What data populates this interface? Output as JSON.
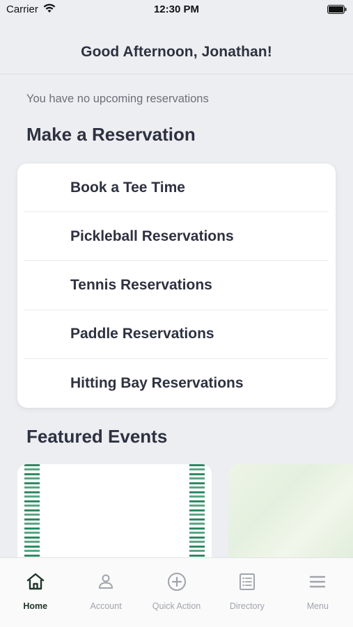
{
  "status_bar": {
    "carrier": "Carrier",
    "time": "12:30 PM"
  },
  "header": {
    "greeting": "Good Afternoon, Jonathan!"
  },
  "reservations": {
    "empty_message": "You have no upcoming reservations",
    "section_title": "Make a Reservation",
    "items": [
      {
        "label": "Book a Tee Time"
      },
      {
        "label": "Pickleball Reservations"
      },
      {
        "label": "Tennis Reservations"
      },
      {
        "label": "Paddle Reservations"
      },
      {
        "label": "Hitting Bay Reservations"
      }
    ]
  },
  "events": {
    "section_title": "Featured Events"
  },
  "tab_bar": {
    "active": "home",
    "active_color": "#1f3528",
    "inactive_color": "#a0a4ab",
    "tabs": [
      {
        "label": "Home",
        "icon": "home-icon"
      },
      {
        "label": "Account",
        "icon": "person-icon"
      },
      {
        "label": "Quick Action",
        "icon": "plus-circle-icon"
      },
      {
        "label": "Directory",
        "icon": "list-icon"
      },
      {
        "label": "Menu",
        "icon": "hamburger-icon"
      }
    ]
  }
}
